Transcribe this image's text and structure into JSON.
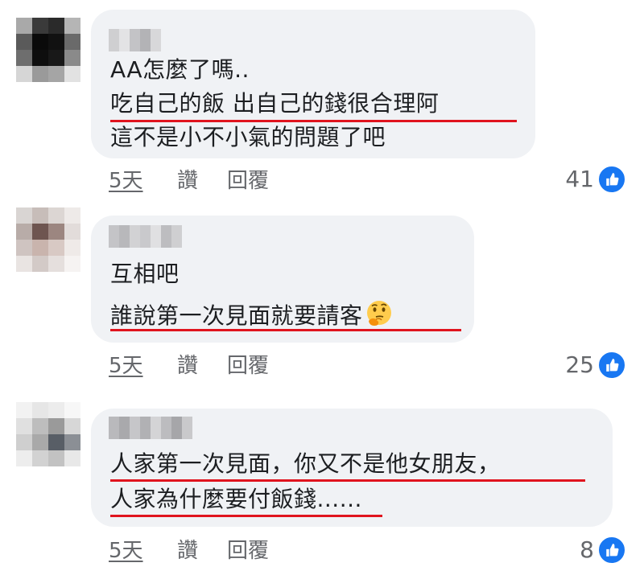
{
  "comments": [
    {
      "lines": [
        "AA怎麼了嗎..",
        "吃自己的飯 出自己的錢很合理阿",
        "這不是小不小氣的問題了吧"
      ],
      "time": "5天",
      "like_label": "讚",
      "reply_label": "回覆",
      "reaction_count": "41",
      "reaction_icon": "like-icon"
    },
    {
      "lines": [
        "互相吧",
        "誰說第一次見面就要請客"
      ],
      "emoji": "thinking-face-emoji",
      "time": "5天",
      "like_label": "讚",
      "reply_label": "回覆",
      "reaction_count": "25",
      "reaction_icon": "like-icon"
    },
    {
      "lines": [
        "人家第一次見面，你又不是他女朋友，",
        "人家為什麼要付飯錢......"
      ],
      "time": "5天",
      "like_label": "讚",
      "reply_label": "回覆",
      "reaction_count": "8",
      "reaction_icon": "like-icon"
    }
  ],
  "colors": {
    "bubble_bg": "#f0f2f5",
    "highlight_underline": "#e0141e",
    "meta_text": "#65676b",
    "like_blue": "#1877f2"
  }
}
